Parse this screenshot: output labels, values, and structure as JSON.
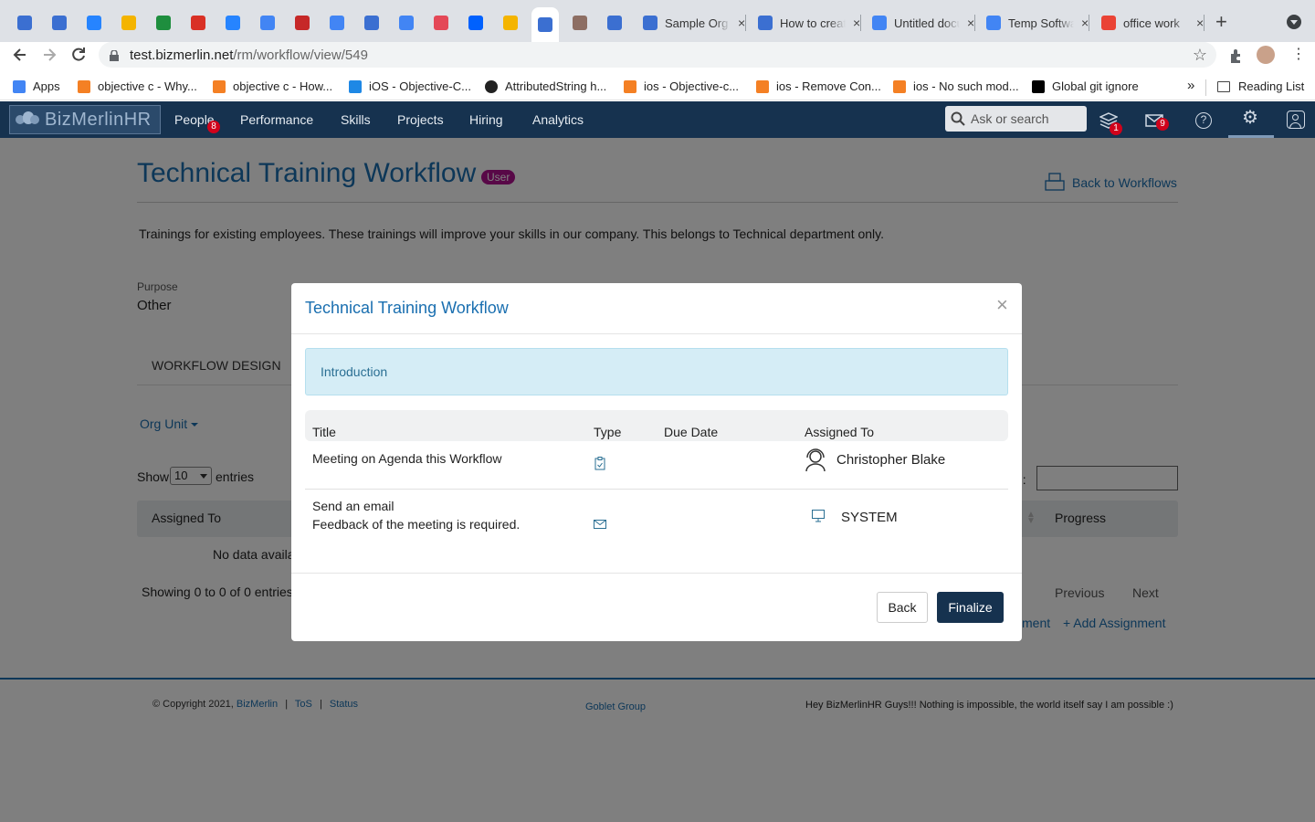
{
  "browser": {
    "pinned_tabs": [
      {
        "icon": "bizmerlin-icon",
        "color": "#3b6fd1"
      },
      {
        "icon": "bizmerlin-icon",
        "color": "#3b6fd1"
      },
      {
        "icon": "jira-icon",
        "color": "#2684ff"
      },
      {
        "icon": "slides-icon",
        "color": "#f4b400"
      },
      {
        "icon": "sheets-icon",
        "color": "#1e8e3e"
      },
      {
        "icon": "gmail-icon",
        "color": "#d93025"
      },
      {
        "icon": "bitbucket-icon",
        "color": "#2684ff"
      },
      {
        "icon": "calendar-icon",
        "color": "#4285f4"
      },
      {
        "icon": "opera-icon",
        "color": "#c62828"
      },
      {
        "icon": "translate-icon",
        "color": "#4285f4"
      },
      {
        "icon": "bizmerlin-icon",
        "color": "#3b6fd1"
      },
      {
        "icon": "docs-icon",
        "color": "#4285f4"
      },
      {
        "icon": "kotlin-icon",
        "color": "#e44857"
      },
      {
        "icon": "dropbox-icon",
        "color": "#0061fe"
      },
      {
        "icon": "slides-icon",
        "color": "#f4b400"
      },
      {
        "icon": "bizmerlin-icon",
        "color": "#3b6fd1",
        "active": true
      },
      {
        "icon": "avatar-icon",
        "color": "#8d6e63"
      },
      {
        "icon": "bizmerlin-icon",
        "color": "#3b6fd1"
      }
    ],
    "tabs": [
      {
        "title": "Sample Org",
        "icon": "bizmerlin-icon",
        "color": "#3b6fd1",
        "close": "×"
      },
      {
        "title": "How to create",
        "icon": "bizmerlin-icon",
        "color": "#3b6fd1",
        "close": "×"
      },
      {
        "title": "Untitled document",
        "icon": "docs-icon",
        "color": "#4285f4",
        "close": "×"
      },
      {
        "title": "Temp Software",
        "icon": "docs-icon",
        "color": "#4285f4",
        "close": "×"
      },
      {
        "title": "office work",
        "icon": "google-icon",
        "color": "#ea4335",
        "close": "×"
      }
    ],
    "new_tab": "+",
    "url_host": "test.bizmerlin.net",
    "url_path": "/rm/workflow/view/549",
    "bookmarks": [
      {
        "label": "Apps",
        "icon": "apps-grid-icon",
        "color": "#4285f4"
      },
      {
        "label": "objective c - Why...",
        "icon": "stackoverflow-icon",
        "color": "#f48024"
      },
      {
        "label": "objective c - How...",
        "icon": "stackoverflow-icon",
        "color": "#f48024"
      },
      {
        "label": "iOS - Objective-C...",
        "icon": "bookmark-site-icon",
        "color": "#1e88e5"
      },
      {
        "label": "AttributedString h...",
        "icon": "github-icon",
        "color": "#222222"
      },
      {
        "label": "ios - Objective-c...",
        "icon": "stackoverflow-icon",
        "color": "#f48024"
      },
      {
        "label": "ios - Remove Con...",
        "icon": "stackoverflow-icon",
        "color": "#f48024"
      },
      {
        "label": "ios - No such mod...",
        "icon": "stackoverflow-icon",
        "color": "#f48024"
      },
      {
        "label": "Global git ignore",
        "icon": "medium-icon",
        "color": "#000000"
      }
    ],
    "more": "»",
    "reading_list": "Reading List"
  },
  "app": {
    "logo": "BizMerlinHR",
    "nav": [
      {
        "label": "People",
        "badge": "8"
      },
      {
        "label": "Performance"
      },
      {
        "label": "Skills"
      },
      {
        "label": "Projects"
      },
      {
        "label": "Hiring"
      },
      {
        "label": "Analytics"
      }
    ],
    "search_placeholder": "Ask or search",
    "inbox_badge": "1",
    "mail_badge": "9"
  },
  "page": {
    "title": "Technical Training Workflow",
    "title_badge": "User",
    "back_link": "Back to Workflows",
    "description": "Trainings for existing employees. These trainings will improve your skills in our company. This belongs to Technical department only.",
    "purpose_label": "Purpose",
    "purpose_value": "Other",
    "tab": "WORKFLOW DESIGN",
    "org_unit": "Org Unit",
    "show_label": "Show",
    "entries_value": "10",
    "entries_label": "entries",
    "search_label": "h:",
    "col_assigned": "Assigned To",
    "col_progress": "Progress",
    "no_data": "No data availa",
    "showing": "Showing 0 to 0 of 0 entries",
    "previous": "Previous",
    "next": "Next",
    "link_partial": "ment",
    "add_assignment": "+ Add Assignment",
    "copyright": "© Copyright 2021,",
    "copyright_link": "BizMerlin",
    "sep": "|",
    "tos": "ToS",
    "status": "Status",
    "goblet": "Goblet Group",
    "footer_msg": "Hey BizMerlinHR Guys!!! Nothing is impossible, the world itself say I am possible :)"
  },
  "modal": {
    "title": "Technical Training Workflow",
    "close": "×",
    "section": "Introduction",
    "headers": {
      "title": "Title",
      "type": "Type",
      "due": "Due Date",
      "assigned": "Assigned To"
    },
    "rows": [
      {
        "title": "Meeting on Agenda this Workflow",
        "subtitle": "",
        "type_icon": "clipboard-icon",
        "due": "",
        "assigned": "Christopher Blake",
        "assignee_icon": "user-headset-icon"
      },
      {
        "title": "Send an email",
        "subtitle": "Feedback of the meeting is required.",
        "type_icon": "envelope-icon",
        "due": "",
        "assigned": "SYSTEM",
        "assignee_icon": "monitor-icon"
      }
    ],
    "back": "Back",
    "finalize": "Finalize"
  }
}
